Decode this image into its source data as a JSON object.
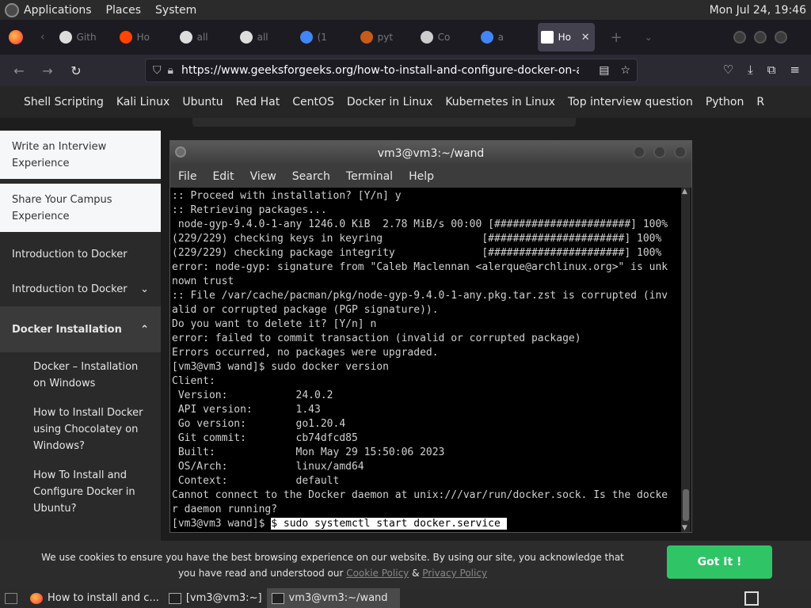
{
  "system_panel": {
    "menus": [
      "Applications",
      "Places",
      "System"
    ],
    "clock": "Mon Jul 24, 19:46"
  },
  "browser": {
    "tabs": [
      {
        "label": "Gith",
        "icon": "github-icon"
      },
      {
        "label": "Ho",
        "icon": "reddit-icon"
      },
      {
        "label": "all",
        "icon": "github-icon"
      },
      {
        "label": "all",
        "icon": "github-icon"
      },
      {
        "label": "(1",
        "icon": "google-icon"
      },
      {
        "label": "pyt",
        "icon": "python-icon"
      },
      {
        "label": "Co",
        "icon": "docker-icon"
      },
      {
        "label": "a",
        "icon": "google-icon"
      },
      {
        "label": "Ho",
        "icon": "gfg-icon",
        "active": true
      }
    ],
    "url": "https://www.geeksforgeeks.org/how-to-install-and-configure-docker-on-arch-b"
  },
  "page": {
    "topnav": [
      "Shell Scripting",
      "Kali Linux",
      "Ubuntu",
      "Red Hat",
      "CentOS",
      "Docker in Linux",
      "Kubernetes in Linux",
      "Top interview question",
      "Python",
      "R"
    ],
    "sidebar": {
      "cards": [
        "Write an Interview Experience",
        "Share Your Campus Experience"
      ],
      "items": [
        {
          "label": "Introduction to Docker",
          "chevron": ""
        },
        {
          "label": "Introduction to Docker",
          "chevron": "⌄"
        },
        {
          "label": "Docker Installation",
          "chevron": "⌃",
          "bold": true
        }
      ],
      "subitems": [
        "Docker – Installation on Windows",
        "How to Install Docker using Chocolatey on Windows?",
        "How To Install and Configure Docker in Ubuntu?"
      ]
    }
  },
  "terminal": {
    "title": "vm3@vm3:~/wand",
    "menu": [
      "File",
      "Edit",
      "View",
      "Search",
      "Terminal",
      "Help"
    ],
    "lines": [
      ":: Proceed with installation? [Y/n] y",
      ":: Retrieving packages...",
      " node-gyp-9.4.0-1-any 1246.0 KiB  2.78 MiB/s 00:00 [######################] 100%",
      "(229/229) checking keys in keyring                [######################] 100%",
      "(229/229) checking package integrity              [######################] 100%",
      "error: node-gyp: signature from \"Caleb Maclennan <alerque@archlinux.org>\" is unk",
      "nown trust",
      ":: File /var/cache/pacman/pkg/node-gyp-9.4.0-1-any.pkg.tar.zst is corrupted (inv",
      "alid or corrupted package (PGP signature)).",
      "Do you want to delete it? [Y/n] n",
      "error: failed to commit transaction (invalid or corrupted package)",
      "Errors occurred, no packages were upgraded.",
      "[vm3@vm3 wand]$ sudo docker version",
      "Client:",
      " Version:           24.0.2",
      " API version:       1.43",
      " Go version:        go1.20.4",
      " Git commit:        cb74dfcd85",
      " Built:             Mon May 29 15:50:06 2023",
      " OS/Arch:           linux/amd64",
      " Context:           default",
      "Cannot connect to the Docker daemon at unix:///var/run/docker.sock. Is the docke",
      "r daemon running?"
    ],
    "prompt": "[vm3@vm3 wand]$ ",
    "current_command": "$ sudo systemctl start docker.service "
  },
  "cookie_banner": {
    "text_before": "We use cookies to ensure you have the best browsing experience on our website. By using our site, you acknowledge that you have read and understood our ",
    "cookie_policy": "Cookie Policy",
    "amp": " & ",
    "privacy_policy": "Privacy Policy",
    "button": "Got It !"
  },
  "taskbar": {
    "tasks": [
      {
        "label": "How to install and c...",
        "icon": "firefox-icon"
      },
      {
        "label": "[vm3@vm3:~]",
        "icon": "terminal-icon"
      },
      {
        "label": "vm3@vm3:~/wand",
        "icon": "terminal-icon",
        "active": true
      }
    ]
  }
}
